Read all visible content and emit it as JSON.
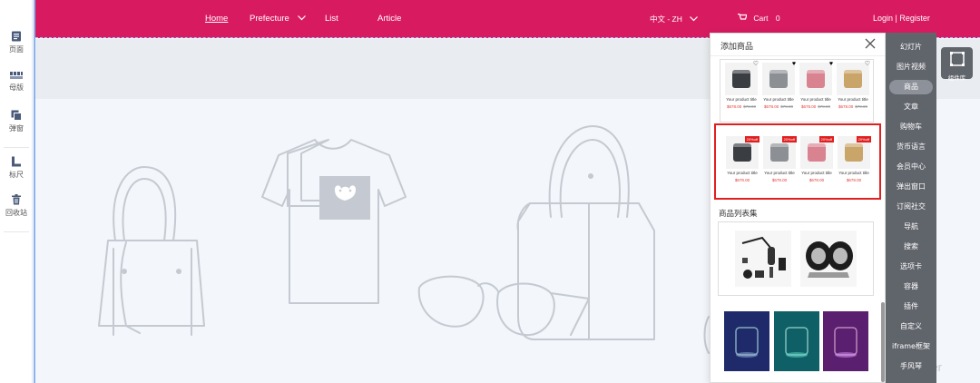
{
  "left_tools": [
    {
      "label": "页面",
      "icon": "page-icon"
    },
    {
      "label": "母版",
      "icon": "template-icon"
    },
    {
      "label": "弹窗",
      "icon": "popup-icon"
    },
    {
      "label": "标尺",
      "icon": "ruler-icon"
    },
    {
      "label": "回收站",
      "icon": "trash-icon"
    }
  ],
  "nav": {
    "home": "Home",
    "prefecture": "Prefecture",
    "list": "List",
    "article": "Article",
    "language": "中文 - ZH",
    "cart": "Cart",
    "cart_count": "0",
    "login": "Login | Register"
  },
  "watermark": "anner",
  "panel": {
    "title": "添加商品",
    "group_a": [
      {
        "name": "Your product title",
        "price": "$678.00",
        "old": "$78.00",
        "color": "#3a3d42",
        "heart": "outline"
      },
      {
        "name": "Your product title",
        "price": "$678.00",
        "old": "$78.00",
        "color": "#8c9095",
        "heart": "filled"
      },
      {
        "name": "Your product title",
        "price": "$678.00",
        "old": "$78.00",
        "color": "#d8838f",
        "heart": "filled"
      },
      {
        "name": "Your product title",
        "price": "$678.00",
        "old": "$78.00",
        "color": "#c9a56a",
        "heart": "outline"
      }
    ],
    "group_b": [
      {
        "name": "Your product title",
        "price": "$678.00",
        "badge": "20%off",
        "color": "#3a3d42"
      },
      {
        "name": "Your product title",
        "price": "$678.00",
        "badge": "20%off",
        "color": "#8c9095"
      },
      {
        "name": "Your product title",
        "price": "$678.00",
        "badge": "20%off",
        "color": "#d8838f"
      },
      {
        "name": "Your product title",
        "price": "$678.00",
        "badge": "20%off",
        "color": "#c9a56a"
      }
    ],
    "list_section_title": "商品列表集",
    "dark_colors": [
      "#1f2a6b",
      "#0f5f66",
      "#5a1f6e"
    ]
  },
  "categories": [
    "幻灯片",
    "图片视频",
    "商品",
    "文章",
    "购物车",
    "货币语言",
    "会员中心",
    "弹出窗口",
    "订阅社交",
    "导航",
    "搜索",
    "选项卡",
    "容器",
    "插件",
    "自定义",
    "iframe框架",
    "手风琴"
  ],
  "active_category": "商品",
  "library_label": "组件库",
  "colors": {
    "brand": "#d81b60",
    "panel_select": "#e02020",
    "category_bg": "#60646b"
  }
}
